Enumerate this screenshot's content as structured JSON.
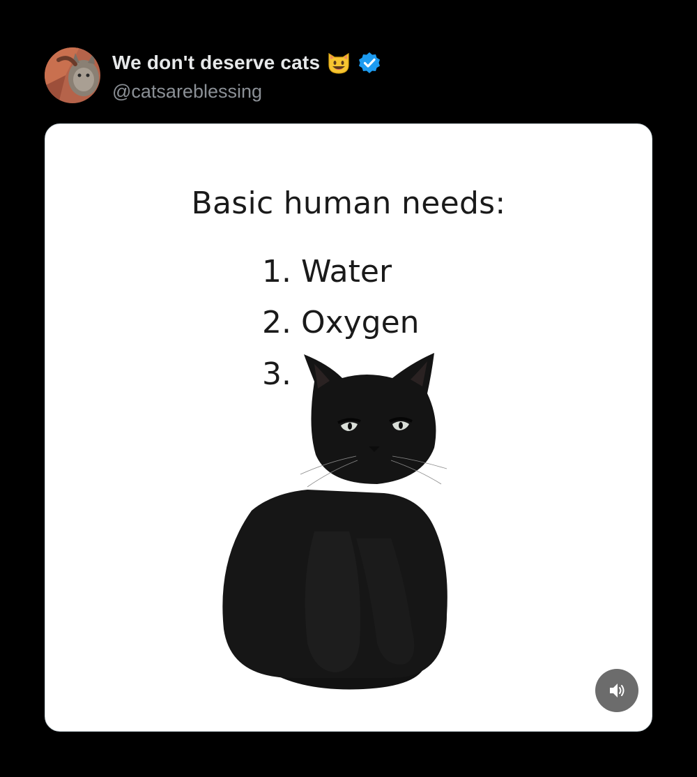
{
  "post": {
    "display_name": "We don't deserve cats",
    "name_emoji": "smiling-cat-emoji",
    "verified_icon": "verified-badge-icon",
    "handle": "@catsareblessing"
  },
  "media": {
    "title": "Basic human needs:",
    "items": [
      "1. Water",
      "2. Oxygen",
      "3."
    ],
    "image_subject": "black-cat",
    "sound_icon": "speaker-icon"
  },
  "colors": {
    "background": "#000000",
    "card": "#ffffff",
    "verified": "#1d9bf0",
    "sound_button": "#6c6c6c"
  }
}
